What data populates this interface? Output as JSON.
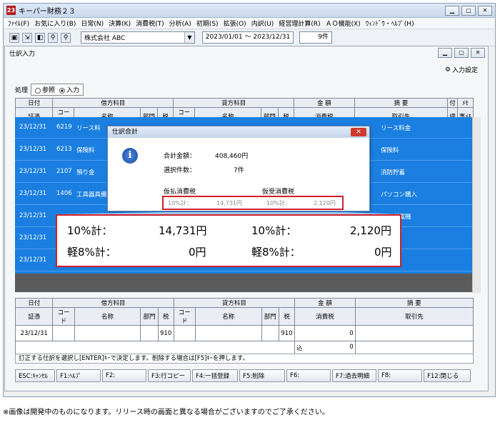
{
  "app": {
    "title": "キーパー財務２３",
    "icon": "23"
  },
  "menu": [
    "ﾌｧｲﾙ(F)",
    "お気に入り(B)",
    "日常(N)",
    "決算(K)",
    "消費税(T)",
    "分析(A)",
    "初期(S)",
    "拡張(O)",
    "内訳(U)",
    "経営理計算(R)",
    "ＡＯ機能(X)",
    "ｳｨﾝﾄﾞｳ・ﾍﾙﾌﾟ(H)"
  ],
  "toolbar": {
    "company": "株式会社 ABC",
    "period": "2023/01/01 ～ 2023/12/31",
    "count": "9件"
  },
  "child": {
    "title": "仕訳入力",
    "settings": "入力設定"
  },
  "process": {
    "label": "処理",
    "options": [
      "参照",
      "入力"
    ],
    "selected": "入力"
  },
  "grid_header": {
    "row1": [
      "日付",
      "借方科目",
      "貸方科目",
      "金 額",
      "摘 要",
      "付",
      "ﾒﾓ"
    ],
    "row2": [
      "証憑",
      "コード",
      "名称",
      "部門",
      "税",
      "コード",
      "名称",
      "部門",
      "税",
      "消費税",
      "取引先",
      "調",
      "事ﾒﾓ"
    ]
  },
  "rows": [
    {
      "date": "23/12/31",
      "code": "6219",
      "name": "リース料",
      "memo": "リース料金"
    },
    {
      "date": "23/12/31",
      "code": "6213",
      "name": "保険料",
      "memo": "保険料"
    },
    {
      "date": "23/12/31",
      "code": "2107",
      "name": "預り金",
      "memo": "消防貯蓄"
    },
    {
      "date": "23/12/31",
      "code": "1406",
      "name": "工具器具備",
      "memo": "パソコン購入"
    },
    {
      "date": "23/12/31",
      "code": "",
      "name": "",
      "memo": "ヤマダ電機"
    },
    {
      "date": "23/12/31",
      "code": "",
      "name": "",
      "memo": "購入"
    },
    {
      "date": "23/12/31",
      "code": "",
      "name": "",
      "memo": "売上"
    }
  ],
  "lower_header": {
    "row1": [
      "日付",
      "借方科目",
      "貸方科目",
      "金 額",
      "摘 要"
    ],
    "row2": [
      "証憑",
      "コード",
      "名称",
      "部門",
      "税",
      "コード",
      "名称",
      "部門",
      "税",
      "消費税",
      "取引先"
    ]
  },
  "lower_rows": {
    "date": "23/12/31",
    "debit_tax": "910",
    "credit_tax": "910",
    "amount": "0",
    "tax_label": "込",
    "tax_amount": "0"
  },
  "status": "訂正する仕訳を選択し[ENTER]ｷｰで決定します。削除する場合は[F5]ｷｰを押します。",
  "fkeys": [
    "ESC:ｷｬﾝｾﾙ",
    "F1:ﾍﾙﾌﾟ",
    "F2:",
    "F3:行コピー",
    "F4:一括登録",
    "F5:削除",
    "F6:",
    "F7:過去明細",
    "F8:",
    "F12:閉じる"
  ],
  "dialog": {
    "title": "仕訳合計",
    "total_label": "合計金額：",
    "total_value": "408,460円",
    "count_label": "選択件数：",
    "count_value": "7件",
    "paid_label": "仮払消費税",
    "received_label": "仮受消費税",
    "paid_row": {
      "label": "10%計：",
      "value": "14,731円"
    },
    "received_row": {
      "label": "10%計：",
      "value": "2,120円"
    }
  },
  "zoom": {
    "r1": {
      "l1": "10%計：",
      "v1": "14,731円",
      "l2": "10%計：",
      "v2": "2,120円"
    },
    "r2": {
      "l1": "軽8%計：",
      "v1": "0円",
      "l2": "軽8%計：",
      "v2": "0円"
    }
  },
  "footnote": "※画像は開発中のものになります。リリース時の画面と異なる場合がございますのでご了承ください。"
}
